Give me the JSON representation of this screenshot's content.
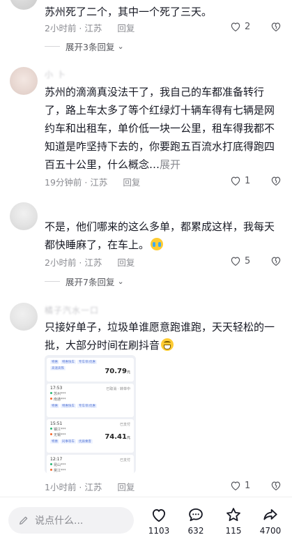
{
  "comments": [
    {
      "text": "苏州死了二个，其中一个死了三天。",
      "time": "2小时前 · 江苏",
      "reply_label": "回复",
      "likes": "2",
      "expand_label": "展开3条回复"
    },
    {
      "username": "小 卜",
      "text": "苏州的滴滴真没法干了，我自己的车都准备转行了，路上车太多了等个红绿灯十辆车得有七辆是网约车和出租车，单价低一块一公里，租车得我都不知道是咋坚持下去的，你要跑五百流水打底得跑四百五十公里，什么概念…",
      "more_label": "展开",
      "time": "19分钟前 · 江苏",
      "reply_label": "回复",
      "likes": "1"
    },
    {
      "text": "不是，他们哪来的这么多单，都累成这样，我每天都快睡麻了，在车上。",
      "emoji": "cry-emoji",
      "time": "2小时前 · 江苏",
      "reply_label": "回复",
      "likes": "5",
      "expand_label": "展开7条回复"
    },
    {
      "username": "橘子汽水一口",
      "text": "只接好单子，垃圾单谁愿意跑谁跑，天天轻松的一批，大部分时间在刷抖音",
      "emoji": "grin-emoji",
      "time": "1小时前 · 江苏",
      "reply_label": "回复",
      "likes": "1",
      "image": {
        "cards": [
          {
            "tags": [
              "特惠",
              "特惠快车",
              "专车单/优惠"
            ],
            "subtag": "高速高铁",
            "price": "70.79",
            "unit": "元"
          },
          {
            "time": "17:53",
            "status": "已取消 · 转单中",
            "from": "苏州***",
            "to": "南通***",
            "tags": [
              "特惠",
              "特惠快车",
              "专车单/优惠"
            ]
          },
          {
            "time": "15:51",
            "status": "已支付",
            "from": "镇江***",
            "to": "无锡***",
            "tags": [
              "特惠",
              "同事等车",
              "优质乘客"
            ],
            "price": "74.41",
            "unit": "元"
          },
          {
            "time": "12:17",
            "status": "已支付",
            "from": "昆山***",
            "to": "吴江***"
          }
        ]
      }
    }
  ],
  "bottom_bar": {
    "input_placeholder": "说点什么...",
    "likes": "1103",
    "comments": "632",
    "favorites": "115",
    "shares": "4700"
  },
  "colors": {
    "text": "#161823",
    "meta": "#8a8b91",
    "divider": "#d6d6d9"
  }
}
